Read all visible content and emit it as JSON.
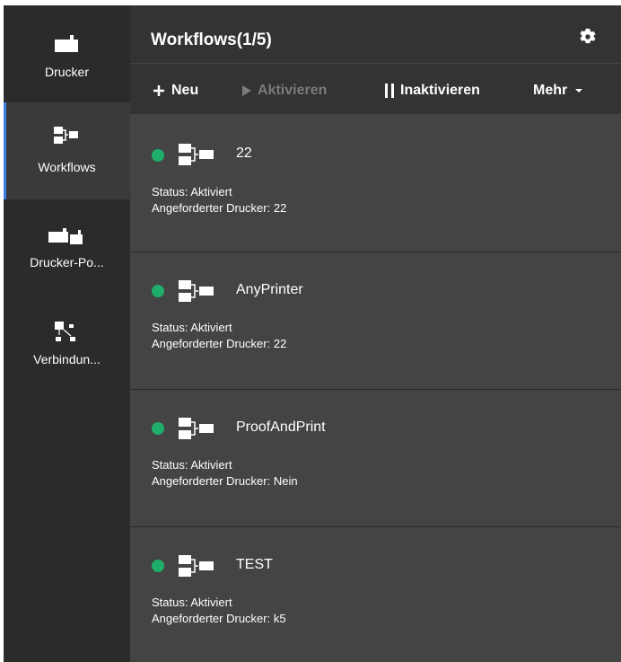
{
  "sidebar": {
    "items": [
      {
        "label": "Drucker",
        "icon": "printer-icon"
      },
      {
        "label": "Workflows",
        "icon": "workflow-icon",
        "active": true
      },
      {
        "label": "Drucker-Po...",
        "icon": "printer-pool-icon"
      },
      {
        "label": "Verbindun...",
        "icon": "connection-icon"
      }
    ]
  },
  "header": {
    "title": "Workflows(1/5)",
    "settings_icon": "gear-icon"
  },
  "toolbar": {
    "new_label": "Neu",
    "activate_label": "Aktivieren",
    "deactivate_label": "Inaktivieren",
    "more_label": "Mehr"
  },
  "workflows": [
    {
      "name": "22",
      "status": "Status: Aktiviert",
      "printer": "Angeforderter Drucker: 22"
    },
    {
      "name": "AnyPrinter",
      "status": "Status: Aktiviert",
      "printer": "Angeforderter Drucker: 22"
    },
    {
      "name": "ProofAndPrint",
      "status": "Status: Aktiviert",
      "printer": "Angeforderter Drucker: Nein"
    },
    {
      "name": "TEST",
      "status": "Status: Aktiviert",
      "printer": "Angeforderter Drucker: k5"
    }
  ],
  "colors": {
    "accent": "#3d7de6",
    "status_active": "#1fae6a",
    "sidebar_bg": "#2b2b2b",
    "card_bg": "#444444"
  }
}
